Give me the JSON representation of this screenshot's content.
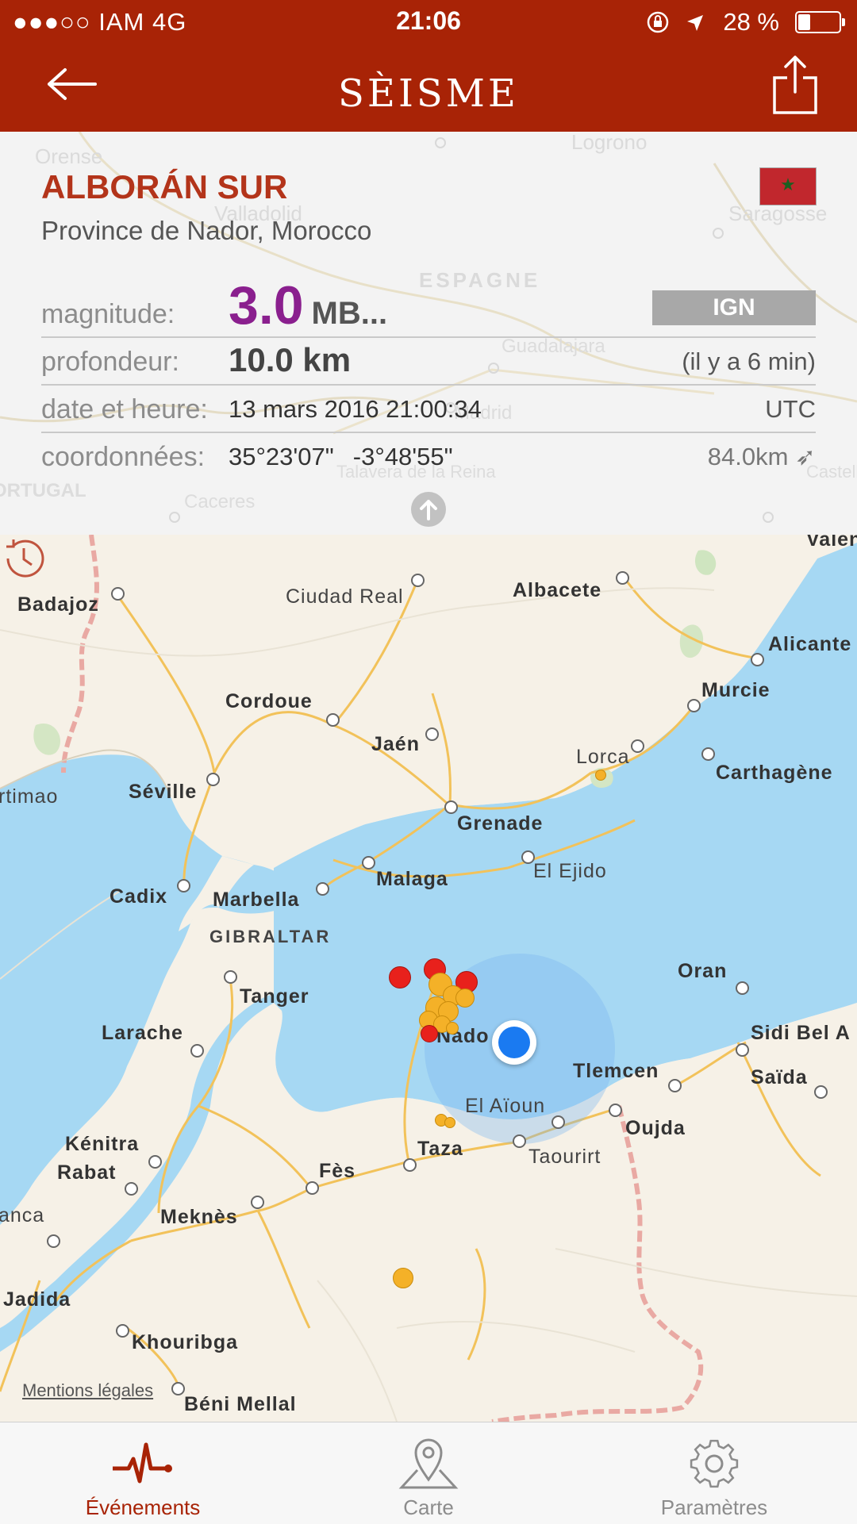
{
  "status_bar": {
    "signal_carrier": "●●●○○ IAM   4G",
    "time": "21:06",
    "right": "28 %"
  },
  "nav": {
    "title": "SÈISME"
  },
  "event": {
    "title": "ALBORÁN SUR",
    "subtitle": "Province de Nador, Morocco",
    "magnitude_label": "magnitude:",
    "magnitude_value": "3.0",
    "magnitude_unit": "MB...",
    "source_badge": "IGN",
    "depth_label": "profondeur:",
    "depth_value": "10.0 km",
    "time_ago": "(il y a 6 min)",
    "datetime_label": "date et heure:",
    "datetime_value": "13 mars 2016 21:00:34",
    "timezone": "UTC",
    "coords_label": "coordonnées:",
    "lat": "35°23'07\"",
    "lon": "-3°48'55\"",
    "distance": "84.0km ➶"
  },
  "ghost_map_labels": [
    "Orense",
    "Logrono",
    "Valladolid",
    "Saragosse",
    "ESPAGNE",
    "Guadalajara",
    "Madrid",
    "Talavera de la Reina",
    "Caceres",
    "Castellon de la Plana",
    "ORTUGAL"
  ],
  "map": {
    "labels": {
      "badajoz": "Badajoz",
      "ciudad_real": "Ciudad Real",
      "albacete": "Albacete",
      "valencia": "Valenci",
      "alicante": "Alicante",
      "cordoue": "Cordoue",
      "murcie": "Murcie",
      "jaen": "Jaén",
      "lorca": "Lorca",
      "carthagene": "Carthagène",
      "portimao": "rtimao",
      "seville": "Séville",
      "grenade": "Grenade",
      "el_ejido": "El Ejido",
      "malaga": "Malaga",
      "cadix": "Cadix",
      "marbella": "Marbella",
      "gibraltar": "GIBRALTAR",
      "oran": "Oran",
      "tanger": "Tanger",
      "sidi_bel_abbes": "Sidi Bel A",
      "larache": "Larache",
      "nador": "Nado",
      "tlemcen": "Tlemcen",
      "saida": "Saïda",
      "el_aioun": "El Aïoun",
      "oujda": "Oujda",
      "kenitra": "Kénitra",
      "taza": "Taza",
      "taourirt": "Taourirt",
      "rabat": "Rabat",
      "fes": "Fès",
      "casablanca": "anca",
      "meknes": "Meknès",
      "jadida": "Jadida",
      "khouribga": "Khouribga",
      "beni_mellal": "Béni Mellal"
    },
    "legal": "Mentions légales"
  },
  "tabs": [
    {
      "label": "Événements",
      "icon": "pulse-icon"
    },
    {
      "label": "Carte",
      "icon": "map-pin-icon"
    },
    {
      "label": "Paramètres",
      "icon": "gear-icon"
    }
  ],
  "colors": {
    "brand": "#a82306",
    "magnitude": "#8a1f8e",
    "quake_red": "#e8211c",
    "quake_orange": "#f4b128",
    "user_location": "#1a7af1",
    "sea": "#a6d8f3"
  }
}
